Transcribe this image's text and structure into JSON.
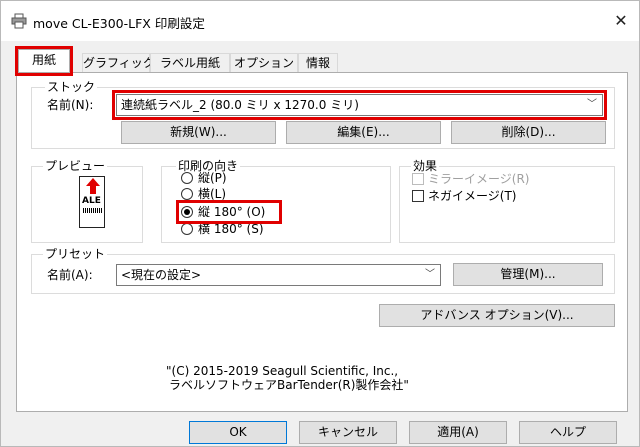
{
  "window": {
    "title": "move CL-E300-LFX 印刷設定",
    "icon": "printer-icon",
    "close_symbol": "✕"
  },
  "tabs": [
    {
      "label": "用紙",
      "active": true
    },
    {
      "label": "グラフィック",
      "active": false
    },
    {
      "label": "ラベル用紙",
      "active": false
    },
    {
      "label": "オプション",
      "active": false
    },
    {
      "label": "情報",
      "active": false
    }
  ],
  "stock": {
    "legend": "ストック",
    "name_label": "名前(N):",
    "name_value": "連続紙ラベル_2 (80.0 ミリ x 1270.0 ミリ)",
    "new_button": "新規(W)...",
    "edit_button": "編集(E)...",
    "delete_button": "削除(D)..."
  },
  "preview": {
    "legend": "プレビュー",
    "sample_text": "ALE"
  },
  "orientation": {
    "legend": "印刷の向き",
    "options": [
      {
        "label": "縦(P)",
        "selected": false
      },
      {
        "label": "横(L)",
        "selected": false
      },
      {
        "label": "縦 180° (O)",
        "selected": true
      },
      {
        "label": "横 180° (S)",
        "selected": false
      }
    ]
  },
  "effects": {
    "legend": "効果",
    "mirror": {
      "label": "ミラーイメージ(R)",
      "checked": false,
      "enabled": false
    },
    "negative": {
      "label": "ネガイメージ(T)",
      "checked": false,
      "enabled": true
    }
  },
  "preset": {
    "legend": "プリセット",
    "name_label": "名前(A):",
    "name_value": "<現在の設定>",
    "manage_button": "管理(M)..."
  },
  "advanced_button": "アドバンス オプション(V)...",
  "copyright": {
    "line1": "\"(C) 2015-2019 Seagull Scientific, Inc.,",
    "line2": "ラベルソフトウェアBarTender(R)製作会社\""
  },
  "footer": {
    "ok": "OK",
    "cancel": "キャンセル",
    "apply": "適用(A)",
    "help": "ヘルプ"
  },
  "colors": {
    "highlight_box": "#e00000",
    "dialog_background": "#f0f0f0",
    "button_face": "#e1e1e1"
  }
}
